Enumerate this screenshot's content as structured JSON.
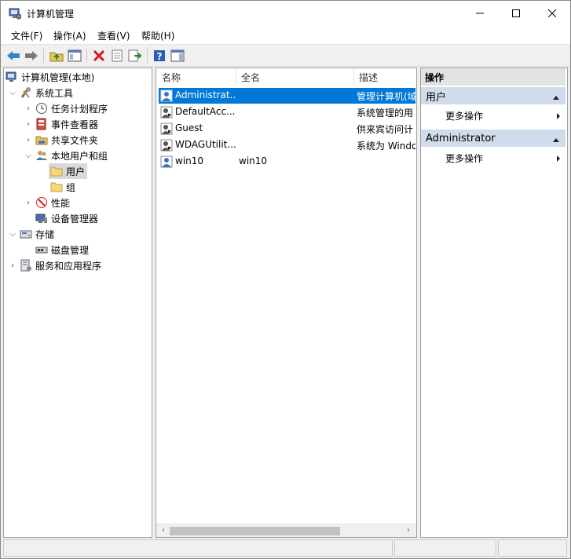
{
  "window": {
    "title": "计算机管理"
  },
  "menu": [
    "文件(F)",
    "操作(A)",
    "查看(V)",
    "帮助(H)"
  ],
  "toolbar": {
    "back": "back-arrow-icon",
    "forward": "forward-arrow-icon",
    "up": "up-folder-icon",
    "show_hide": "show-hide-tree-icon",
    "delete": "delete-icon",
    "properties": "properties-icon",
    "export": "export-list-icon",
    "help": "help-icon",
    "action_pane": "action-pane-icon"
  },
  "tree": {
    "root": "计算机管理(本地)",
    "system_tools": "系统工具",
    "task_scheduler": "任务计划程序",
    "event_viewer": "事件查看器",
    "shared_folders": "共享文件夹",
    "local_users_groups": "本地用户和组",
    "users": "用户",
    "groups": "组",
    "performance": "性能",
    "device_manager": "设备管理器",
    "storage": "存储",
    "disk_management": "磁盘管理",
    "services_apps": "服务和应用程序"
  },
  "list": {
    "columns": [
      "名称",
      "全名",
      "描述"
    ],
    "rows": [
      {
        "name": "Administrat...",
        "full": "",
        "desc": "管理计算机(域"
      },
      {
        "name": "DefaultAcc...",
        "full": "",
        "desc": "系统管理的用"
      },
      {
        "name": "Guest",
        "full": "",
        "desc": "供来宾访问计"
      },
      {
        "name": "WDAGUtilit...",
        "full": "",
        "desc": "系统为 Windo"
      },
      {
        "name": "win10",
        "full": "win10",
        "desc": ""
      }
    ]
  },
  "actions": {
    "header": "操作",
    "section1": "用户",
    "more1": "更多操作",
    "section2": "Administrator",
    "more2": "更多操作"
  },
  "colors": {
    "selection": "#0078d7",
    "section_bg": "#d0dceb"
  }
}
